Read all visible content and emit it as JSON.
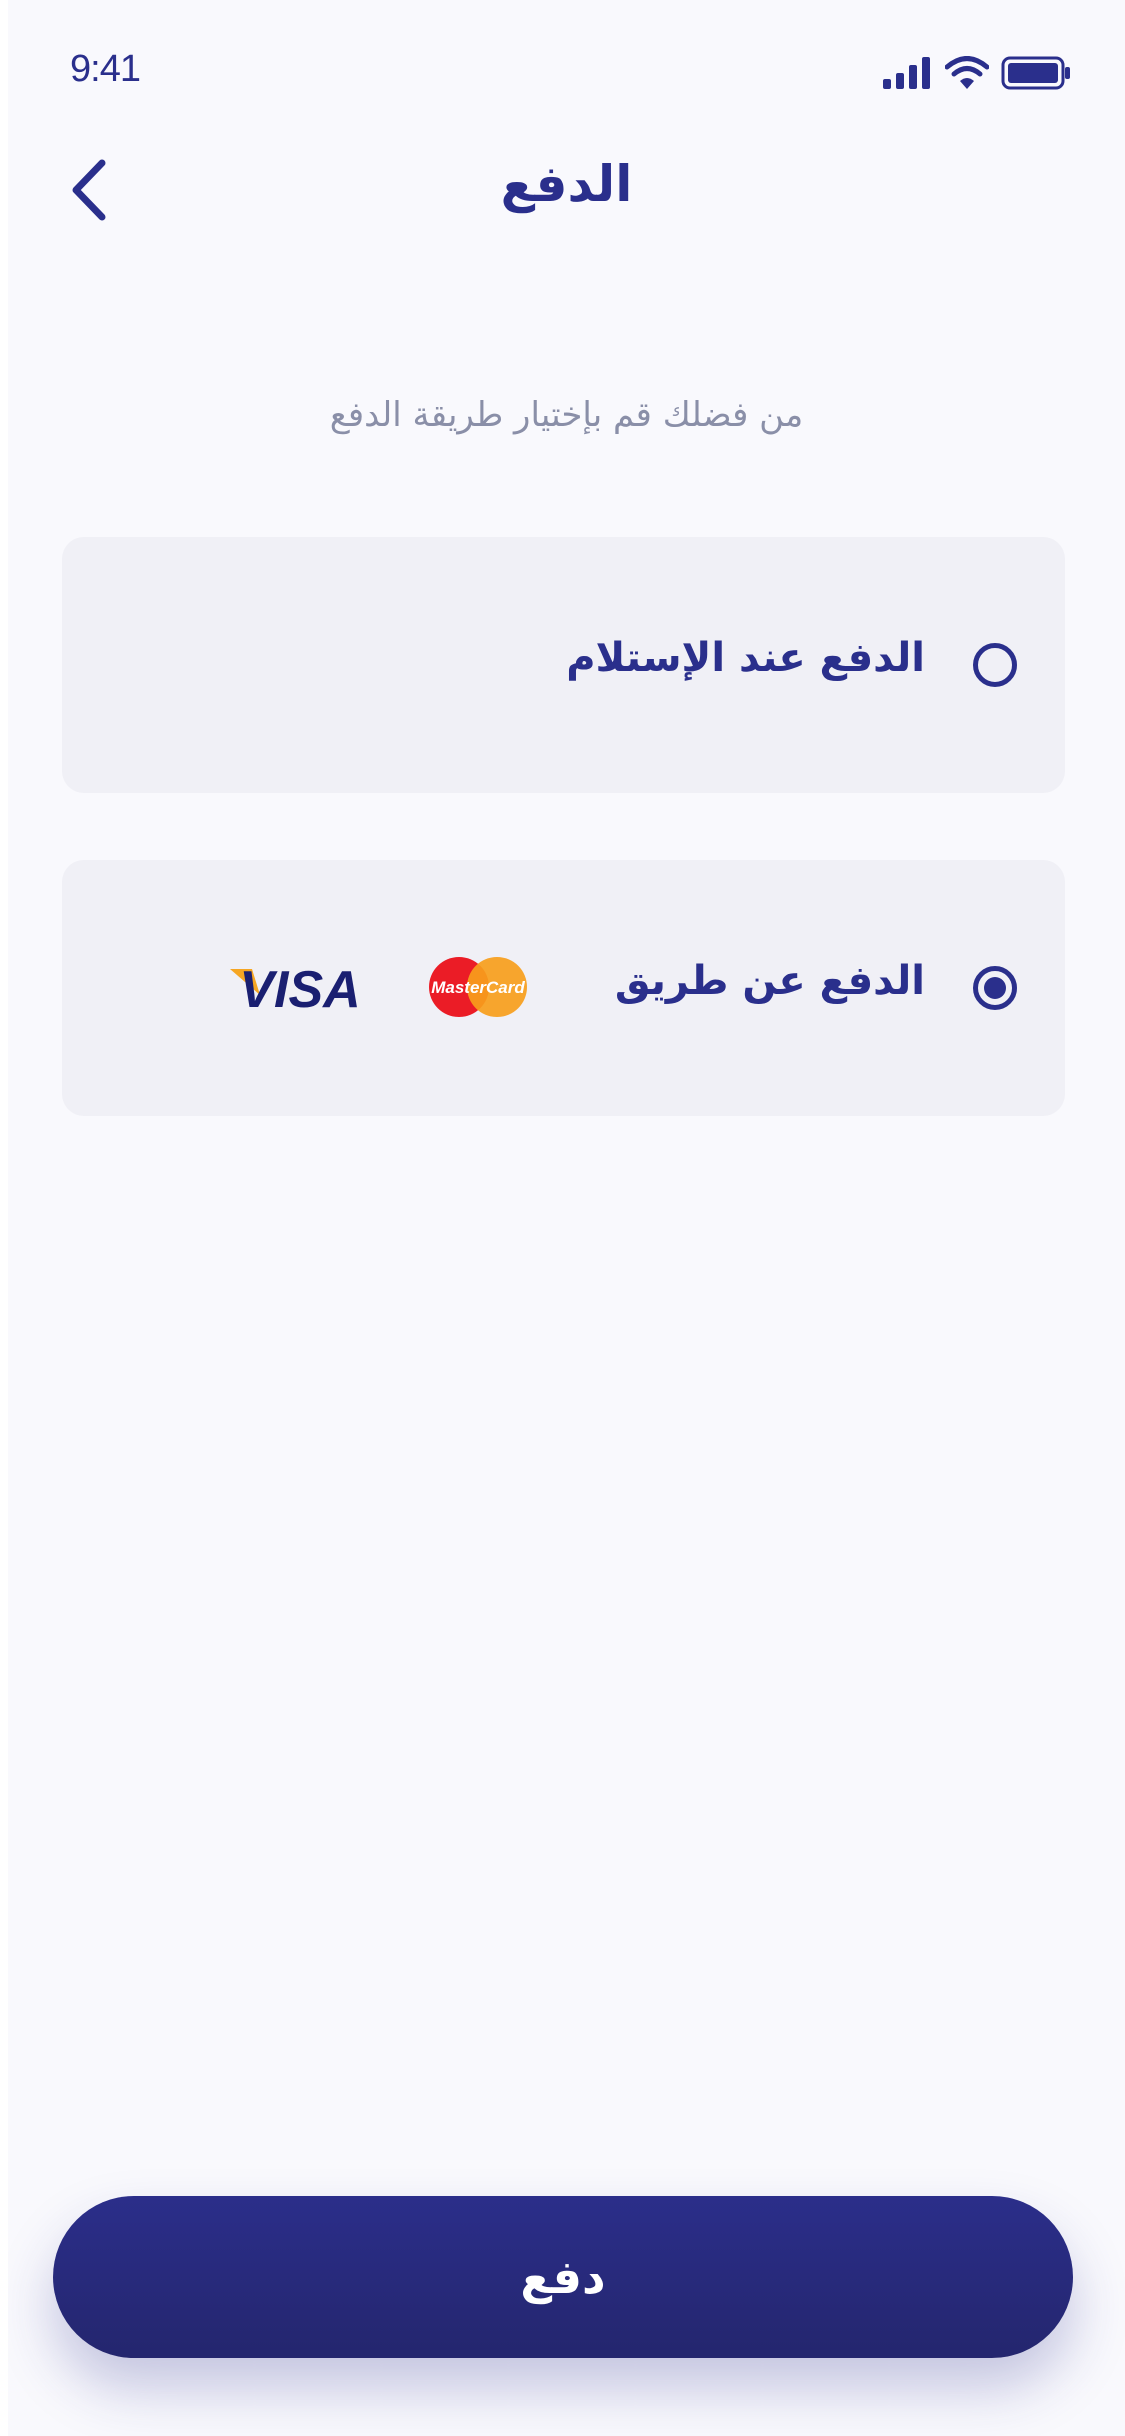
{
  "status_bar": {
    "time": "9:41",
    "icons": [
      "cellular-signal-icon",
      "wifi-icon",
      "battery-icon"
    ]
  },
  "header": {
    "back_icon": "chevron-left-icon",
    "title": "الدفع"
  },
  "subtitle": "من فضلك قم بإختيار طريقة الدفع",
  "payment_options": [
    {
      "label": "الدفع عند الإستلام",
      "selected": false
    },
    {
      "label": "الدفع عن طريق",
      "selected": true,
      "logos": [
        "VISA",
        "MasterCard"
      ]
    }
  ],
  "pay_button": {
    "label": "دفع"
  },
  "colors": {
    "primary": "#2a2f8c",
    "background": "#f9f9fd",
    "card": "#f0f0f6",
    "subtitle": "#8a8fa8"
  }
}
